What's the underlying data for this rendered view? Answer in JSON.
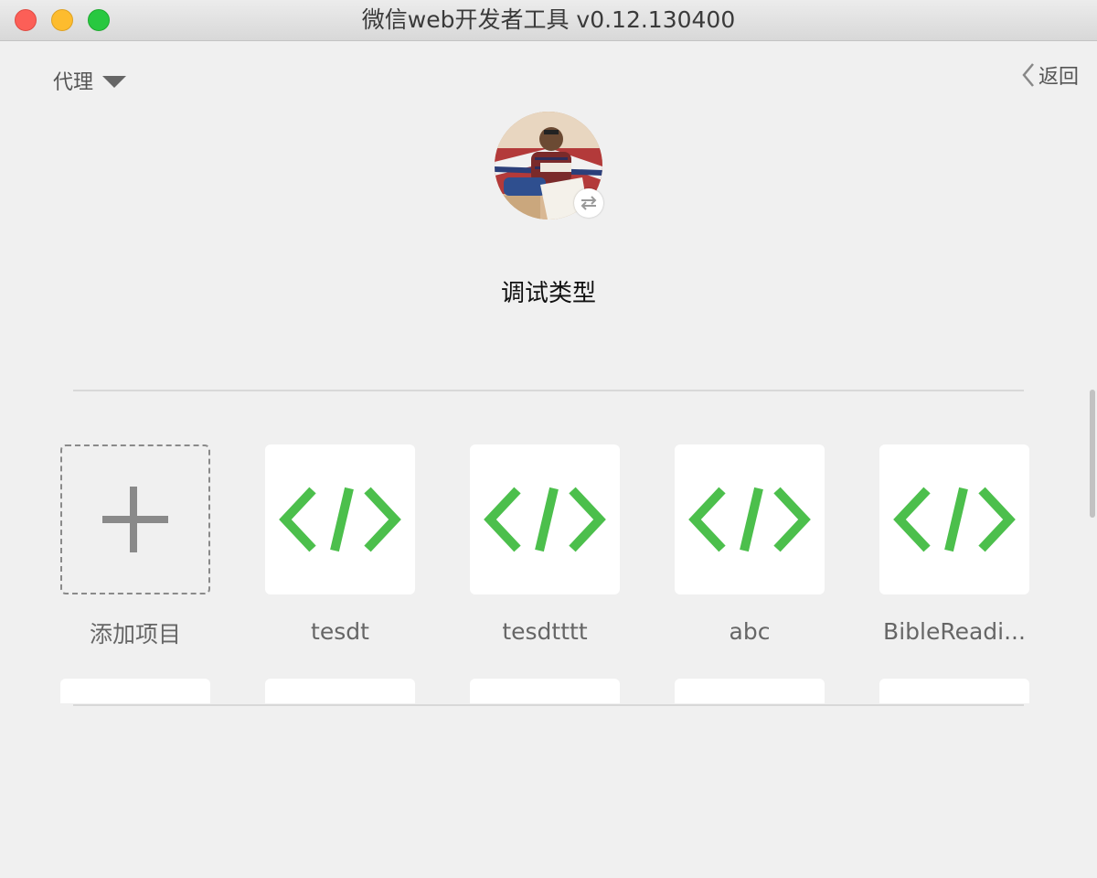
{
  "window": {
    "title": "微信web开发者工具 v0.12.130400"
  },
  "header": {
    "proxy_label": "代理",
    "back_label": "返回"
  },
  "profile": {
    "debug_type_label": "调试类型"
  },
  "projects": {
    "add_label": "添加项目",
    "items": [
      {
        "name": "tesdt"
      },
      {
        "name": "tesdtttt"
      },
      {
        "name": "abc"
      },
      {
        "name": "BibleReadi..."
      }
    ]
  },
  "colors": {
    "code_icon": "#4cbf4c",
    "plus_icon": "#8a8a8a",
    "traffic_close": "#fc5f57",
    "traffic_min": "#fdbc2e",
    "traffic_max": "#28c840"
  },
  "icons": {
    "add": "plus-icon",
    "project": "code-icon",
    "switch": "switch-arrows-icon",
    "back": "chevron-left-icon",
    "dropdown": "caret-down-icon"
  }
}
